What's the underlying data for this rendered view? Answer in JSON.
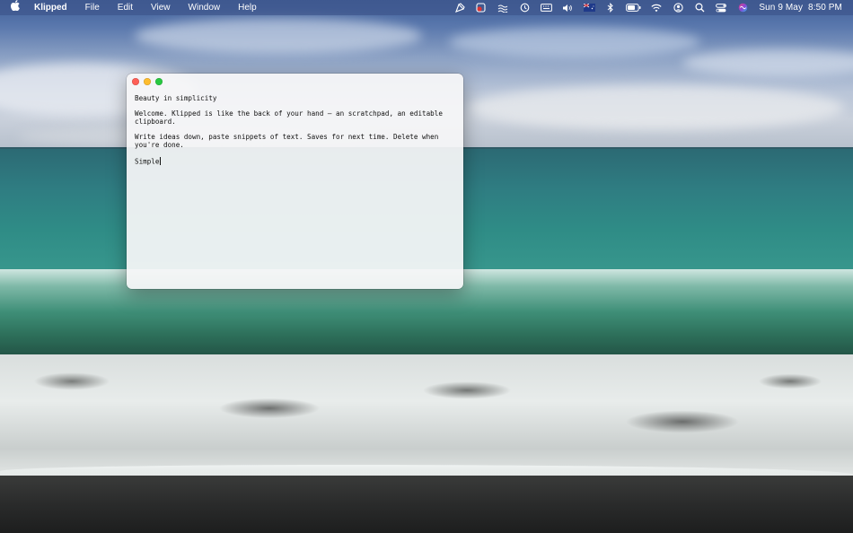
{
  "menubar": {
    "apple_icon": "apple-icon",
    "app_name": "Klipped",
    "menus": [
      "File",
      "Edit",
      "View",
      "Window",
      "Help"
    ],
    "status_icons": [
      "pen-tool-icon",
      "app-badge-icon",
      "waves-icon",
      "clock-history-icon",
      "keyboard-icon",
      "volume-icon",
      "flag-icon",
      "bluetooth-icon",
      "battery-icon",
      "wifi-icon",
      "user-circle-icon",
      "search-icon",
      "control-center-icon",
      "siri-icon"
    ],
    "clock": {
      "date": "Sun 9 May",
      "time": "8:50 PM"
    }
  },
  "window": {
    "lines": [
      "Beauty in simplicity",
      "Welcome. Klipped is like the back of your hand – an scratchpad, an editable clipboard.",
      "Write ideas down, paste snippets of text. Saves for next time. Delete when you're done.",
      "Simple"
    ]
  },
  "colors": {
    "menubar_bg": "#3e568c",
    "close": "#fe5f57",
    "minimize": "#febc2e",
    "zoom": "#28c840"
  }
}
